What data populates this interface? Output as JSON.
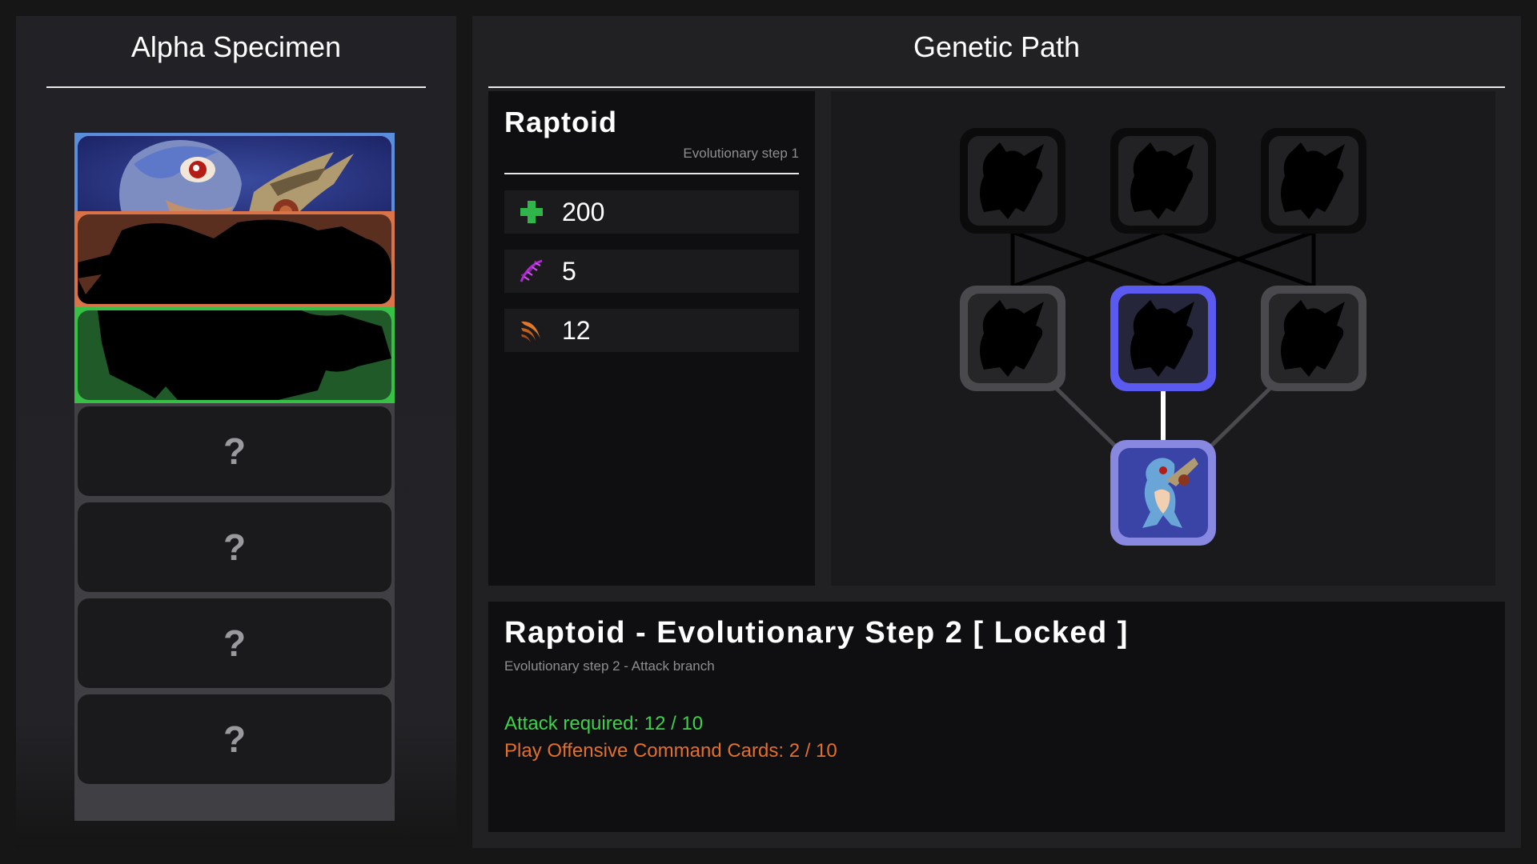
{
  "left_panel": {
    "title": "Alpha Specimen",
    "slots": [
      {
        "state": "unlocked",
        "frame_color": "#5a8edc",
        "bg_color": "#263277"
      },
      {
        "state": "silhouette",
        "frame_color": "#d8734a",
        "bg_color": "#5a2f20"
      },
      {
        "state": "silhouette",
        "frame_color": "#36c046",
        "bg_color": "#1f5a28"
      },
      {
        "state": "unknown",
        "icon": "question-icon"
      },
      {
        "state": "unknown",
        "icon": "question-icon"
      },
      {
        "state": "unknown",
        "icon": "question-icon"
      },
      {
        "state": "unknown",
        "icon": "question-icon"
      }
    ]
  },
  "right_panel": {
    "title": "Genetic Path"
  },
  "stats": {
    "name": "Raptoid",
    "step": "Evolutionary step 1",
    "rows": [
      {
        "icon": "health-cross-icon",
        "value": "200",
        "color": "#2fb54a"
      },
      {
        "icon": "dna-icon",
        "value": "5",
        "color": "#b02ad2"
      },
      {
        "icon": "claw-icon",
        "value": "12",
        "color": "#e07a2a"
      }
    ]
  },
  "tree": {
    "nodes": [
      {
        "id": "t1",
        "tier": 3,
        "state": "locked"
      },
      {
        "id": "t2",
        "tier": 3,
        "state": "locked"
      },
      {
        "id": "t3",
        "tier": 3,
        "state": "locked"
      },
      {
        "id": "m1",
        "tier": 2,
        "state": "available"
      },
      {
        "id": "m2",
        "tier": 2,
        "state": "selected"
      },
      {
        "id": "m3",
        "tier": 2,
        "state": "available"
      },
      {
        "id": "root",
        "tier": 1,
        "state": "current"
      }
    ],
    "colors": {
      "locked": "#0b0b0c",
      "available": "#4a4a4e",
      "selected": "#5a5af0",
      "current": "#8888e0"
    }
  },
  "info": {
    "title": "Raptoid - Evolutionary Step 2 [ Locked ]",
    "subtitle": "Evolutionary step 2 - Attack branch",
    "requirements": [
      {
        "text": "Attack required: 12 / 10",
        "color": "#3dd24a"
      },
      {
        "text": "Play Offensive Command Cards: 2 / 10",
        "color": "#e0702c"
      }
    ]
  }
}
